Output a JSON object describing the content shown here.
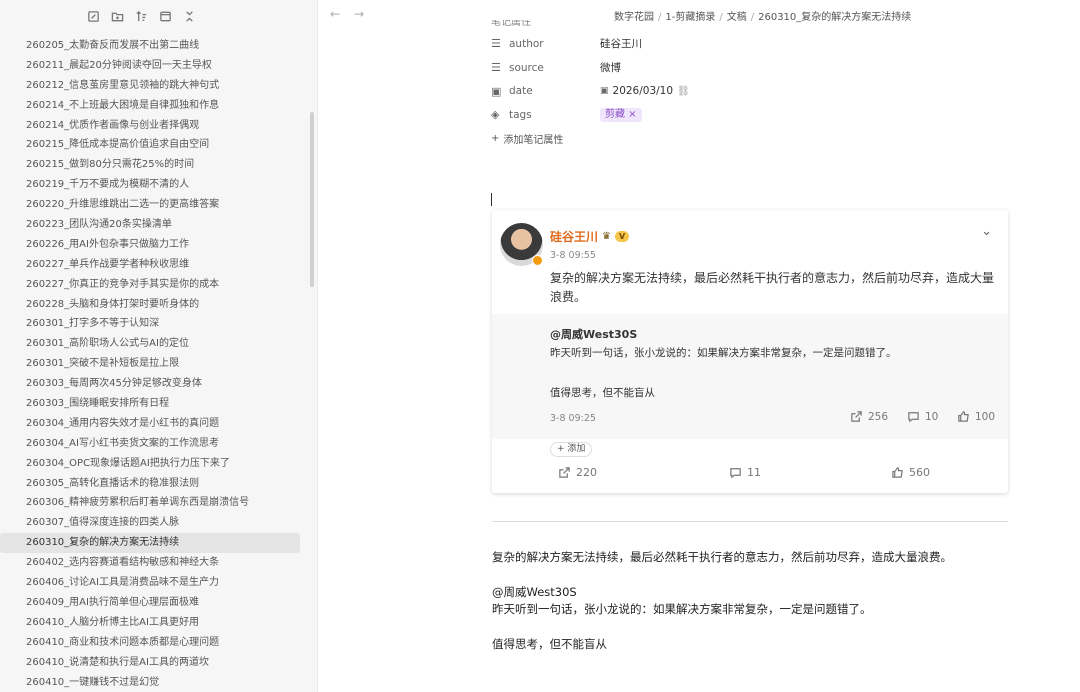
{
  "sidebar": {
    "toolbar_icons": [
      "new-note-icon",
      "new-folder-icon",
      "sort-icon",
      "collapse-icon",
      "close-all-icon"
    ],
    "items": [
      "260205_太勤奋反而发展不出第二曲线",
      "260211_晨起20分钟阅读夺回一天主导权",
      "260212_信息茧房里意见领袖的跳大神句式",
      "260214_不上班最大困境是自律孤独和作息",
      "260214_优质作者画像与创业者择偶观",
      "260215_降低成本提高价值追求自由空间",
      "260215_做到80分只需花25%的时间",
      "260219_千万不要成为模糊不清的人",
      "260220_升维思维跳出二选一的更高维答案",
      "260223_团队沟通20条实操清单",
      "260226_用AI外包杂事只做脑力工作",
      "260227_单兵作战要学者种秋收思维",
      "260227_你真正的竞争对手其实是你的成本",
      "260228_头脑和身体打架时要听身体的",
      "260301_打字多不等于认知深",
      "260301_高阶职场人公式与AI的定位",
      "260301_突破不是补短板是拉上限",
      "260303_每周两次45分钟足够改变身体",
      "260303_围绕睡眠安排所有日程",
      "260304_通用内容失效才是小红书的真问题",
      "260304_AI写小红书卖货文案的工作流思考",
      "260304_OPC现象爆话题AI把执行力压下来了",
      "260305_高转化直播话术的稳准狠法则",
      "260306_精神疲劳累积后盯着单调东西是崩溃信号",
      "260307_值得深度连接的四类人脉",
      "260310_复杂的解决方案无法持续",
      "260402_选内容赛道看结构敏感和神经大条",
      "260406_讨论AI工具是消费品味不是生产力",
      "260409_用AI执行简单但心理层面极难",
      "260410_人脑分析博主比AI工具更好用",
      "260410_商业和技术问题本质都是心理问题",
      "260410_说清楚和执行是AI工具的两道坎",
      "260410_一键赚钱不过是幻觉"
    ],
    "active_index": 25
  },
  "topbar": {
    "back": "←",
    "forward": "→",
    "breadcrumb": [
      "数字花园",
      "1-剪藏摘录",
      "文稿",
      "260310_复杂的解决方案无法持续"
    ]
  },
  "props": {
    "cut_heading": "笔记属性",
    "rows": [
      {
        "icon": "list-icon",
        "key": "author",
        "value": "硅谷王川"
      },
      {
        "icon": "list-icon",
        "key": "source",
        "value": "微博"
      },
      {
        "icon": "calendar-icon",
        "key": "date",
        "value": "2026/03/10"
      },
      {
        "icon": "tag-icon",
        "key": "tags",
        "value": "剪藏"
      }
    ],
    "add_label": "添加笔记属性"
  },
  "card": {
    "author": "硅谷王川",
    "vip": "V",
    "time": "3-8 09:55",
    "text": "复杂的解决方案无法持续，最后必然耗干执行者的意志力，然后前功尽弃，造成大量浪费。",
    "repost": {
      "author": "@周威West30S",
      "line1": "昨天听到一句话，张小龙说的：如果解决方案非常复杂，一定是问题错了。",
      "line2": "值得思考，但不能盲从",
      "time": "3-8 09:25",
      "shares": "256",
      "comments": "10",
      "likes": "100"
    },
    "add_label": "+ 添加",
    "shares": "220",
    "comments": "11",
    "likes": "560"
  },
  "body": {
    "p1": "复杂的解决方案无法持续，最后必然耗干执行者的意志力，然后前功尽弃，造成大量浪费。",
    "p2a": "@周威West30S",
    "p2b": "昨天听到一句话，张小龙说的：如果解决方案非常复杂，一定是问题错了。",
    "p3": "值得思考，但不能盲从"
  }
}
